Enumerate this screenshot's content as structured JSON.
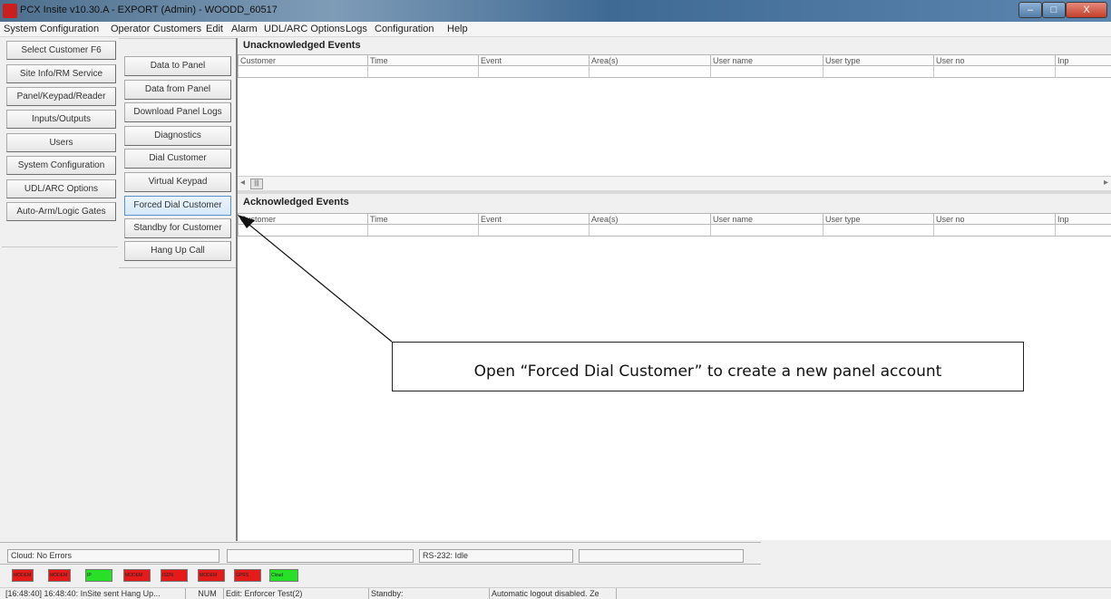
{
  "window": {
    "title": "PCX Insite v10.30.A - EXPORT (Admin) - WOODD_60517",
    "controls": {
      "minimize": "–",
      "maximize": "□",
      "close": "X"
    }
  },
  "menu": [
    "System Configuration",
    "Operator",
    "Customers",
    "Edit",
    "Alarm",
    "UDL/ARC Options",
    "Logs",
    "Configuration",
    "Help"
  ],
  "left_buttons": [
    "Select Customer F6",
    "Site Info/RM Service",
    "Panel/Keypad/Reader",
    "Inputs/Outputs",
    "Users",
    "System Configuration",
    "UDL/ARC Options",
    "Auto-Arm/Logic Gates"
  ],
  "mid_buttons": [
    "Data to Panel",
    "Data from Panel",
    "Download Panel Logs",
    "Diagnostics",
    "Dial Customer",
    "Virtual Keypad",
    "Forced Dial Customer",
    "Standby for Customer",
    "Hang Up Call"
  ],
  "unack": {
    "title": "Unacknowledged Events",
    "columns": [
      "Customer",
      "Time",
      "Event",
      "Area(s)",
      "User name",
      "User type",
      "User no",
      "Inp"
    ]
  },
  "ack": {
    "title": "Acknowledged Events",
    "columns": [
      "Customer",
      "Time",
      "Event",
      "Area(s)",
      "User name",
      "User type",
      "User no",
      "Inp"
    ]
  },
  "scroll": {
    "left": "◂",
    "thumb": "|||",
    "right": "▸"
  },
  "callout": "Open “Forced Dial Customer” to create a new panel account",
  "status_fields": {
    "cloud": "Cloud: No Errors",
    "rs232": "RS-232: Idle"
  },
  "indicators": [
    {
      "label": "MODEM",
      "color": "#e51b1b"
    },
    {
      "label": "MODEM",
      "color": "#e51b1b"
    },
    {
      "label": "IP",
      "color": "#27e027"
    },
    {
      "label": "MODEM",
      "color": "#e51b1b"
    },
    {
      "label": "ISDN",
      "color": "#e51b1b"
    },
    {
      "label": "MODEM",
      "color": "#e51b1b"
    },
    {
      "label": "GPRS",
      "color": "#e51b1b"
    },
    {
      "label": "Cloud",
      "color": "#27e027"
    }
  ],
  "statusbar": [
    "[16:48:40] 16:48:40: InSite sent Hang Up...",
    "NUM",
    "Edit: Enforcer Test(2)",
    "Standby:",
    "Automatic logout disabled. Ze"
  ]
}
